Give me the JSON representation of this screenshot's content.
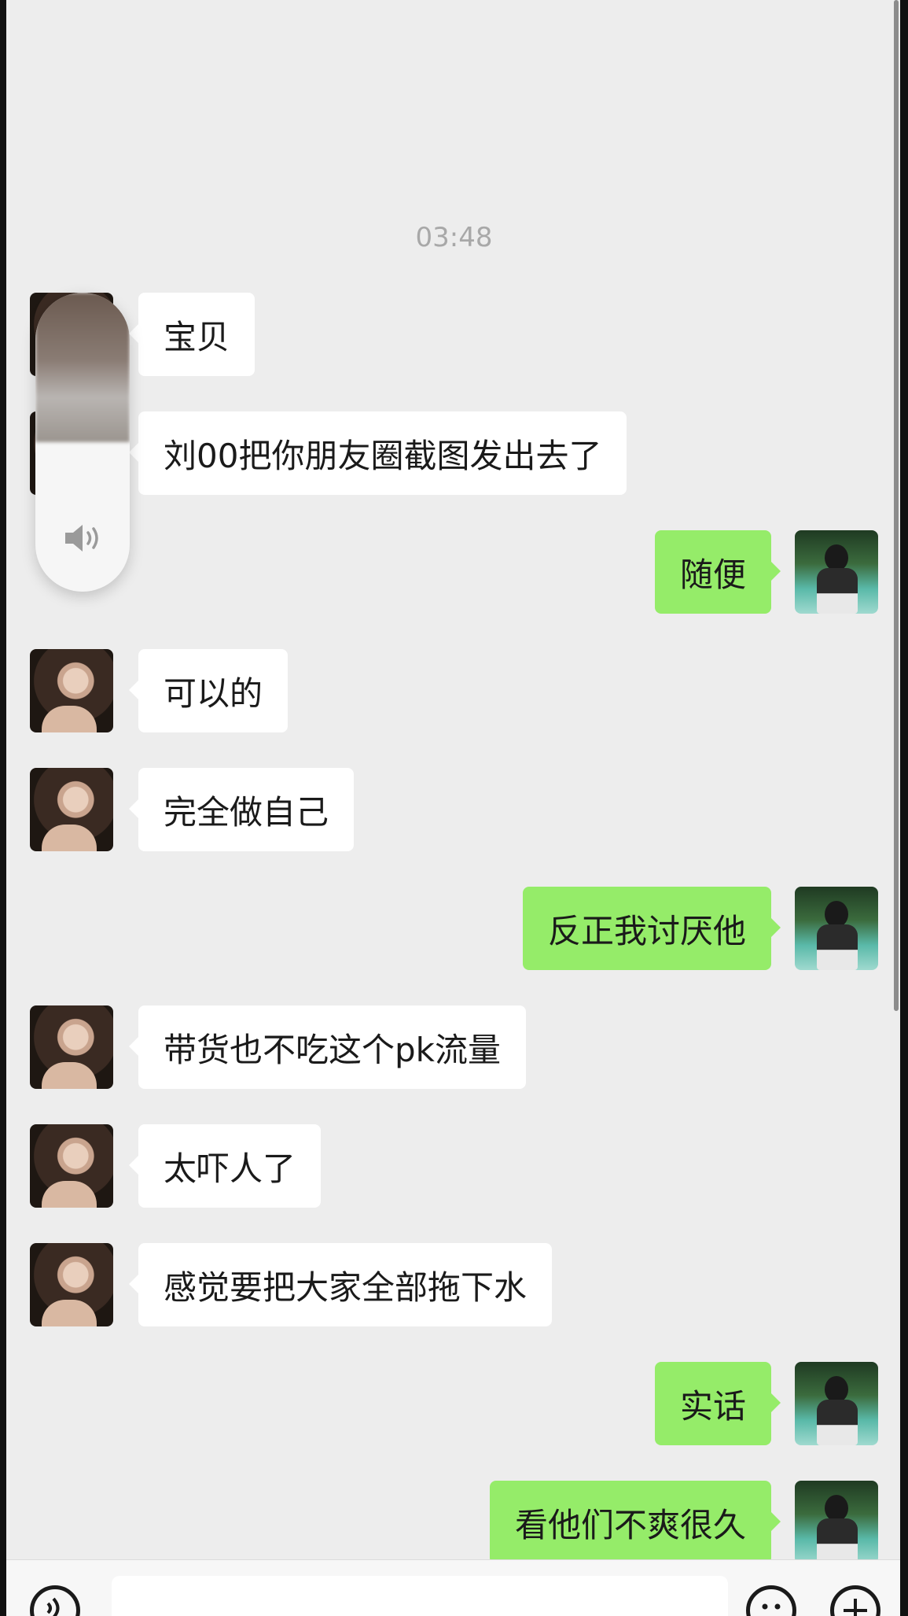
{
  "chat": {
    "timestamp": "03:48",
    "messages": [
      {
        "side": "left",
        "text": "宝贝"
      },
      {
        "side": "left",
        "text": "刘00把你朋友圈截图发出去了"
      },
      {
        "side": "right",
        "text": "随便"
      },
      {
        "side": "left",
        "text": "可以的"
      },
      {
        "side": "left",
        "text": "完全做自己"
      },
      {
        "side": "right",
        "text": "反正我讨厌他"
      },
      {
        "side": "left",
        "text": "带货也不吃这个pk流量"
      },
      {
        "side": "left",
        "text": "太吓人了"
      },
      {
        "side": "left",
        "text": "感觉要把大家全部拖下水"
      },
      {
        "side": "right",
        "text": "实话"
      },
      {
        "side": "right",
        "text": "看他们不爽很久"
      }
    ]
  },
  "overlay": {
    "volume_icon": "speaker-icon",
    "volume_level": 0.5
  },
  "input_bar": {
    "voice_icon": "voice-icon",
    "emoji_icon": "emoji-icon",
    "plus_icon": "plus-icon"
  },
  "colors": {
    "background": "#ededed",
    "bubble_received": "#ffffff",
    "bubble_sent": "#95ec69",
    "timestamp": "#a8a8a8"
  }
}
